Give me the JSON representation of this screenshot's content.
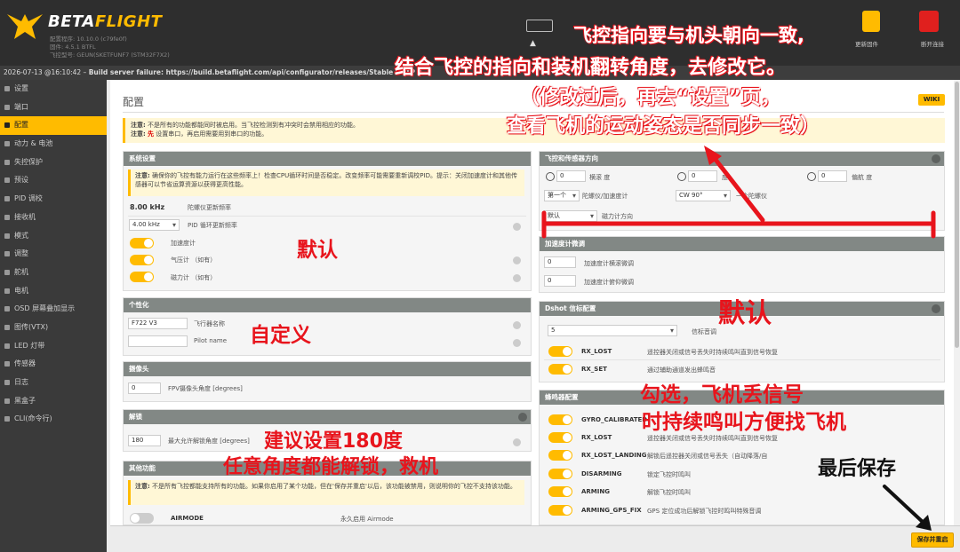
{
  "header": {
    "logo_part1": "BETA",
    "logo_part2": "FLIGHT",
    "fw_line1": "配置程序: 10.10.0 (c79fe0f)",
    "fw_line2": "固件: 4.5.1 BTFL",
    "fw_line3": "飞控型号: GEUN(SKETFUNF7 (STM32F7X2)",
    "right_label1": "更新固件",
    "right_label2": "断开连接",
    "accent_color": "#ffbb00",
    "icons": [
      "betaflight-logo",
      "usb-icon",
      "warning-icon",
      "chip-icon",
      "disconnect-icon"
    ]
  },
  "logbar": {
    "timestamp": "2026-07-13 @16:10:42 –",
    "message": "Build server failure: https://build.betaflight.com/api/configurator/releases/Stable HTTP",
    "code": "0"
  },
  "sidebar": {
    "items": [
      {
        "label": "设置"
      },
      {
        "label": "端口"
      },
      {
        "label": "配置",
        "active": true
      },
      {
        "label": "动力 & 电池"
      },
      {
        "label": "失控保护"
      },
      {
        "label": "预设"
      },
      {
        "label": "PID 调校"
      },
      {
        "label": "接收机"
      },
      {
        "label": "模式"
      },
      {
        "label": "调整"
      },
      {
        "label": "舵机"
      },
      {
        "label": "电机"
      },
      {
        "label": "OSD 屏幕叠加显示"
      },
      {
        "label": "图传(VTX)"
      },
      {
        "label": "LED 灯带"
      },
      {
        "label": "传感器"
      },
      {
        "label": "日志"
      },
      {
        "label": "黑盒子"
      },
      {
        "label": "CLI(命令行)"
      }
    ]
  },
  "page": {
    "title": "配置",
    "wiki": "WIKI",
    "notice_b1": "注意:",
    "notice_t1": "不是所有的功能都能同时被启用。当飞控检测到有冲突时会禁用相应的功能。",
    "notice_b2": "注意:",
    "notice_b3": "先",
    "notice_t2": "设置串口，再启用需要用到串口的功能。"
  },
  "system": {
    "title": "系统设置",
    "note_b": "注意:",
    "note_t": "确保你的飞控有能力运行在这些频率上！检查CPU循环时间是否稳定。改变频率可能需要重新调校PID。提示：关闭加速度计和其他传感器可以节省运算资源以获得更高性能。",
    "gyro_freq": "8.00 kHz",
    "gyro_freq_label": "陀螺仪更新频率",
    "pid_freq": "4.00 kHz",
    "pid_freq_label": "PID 循环更新频率",
    "accel": "加速度计",
    "baro": "气压计 （如有）",
    "mag": "磁力计 （如有）"
  },
  "personal": {
    "title": "个性化",
    "craft_name": "F722 V3",
    "craft_name_label": "飞行器名称",
    "pilot_name": "",
    "pilot_name_label": "Pilot name"
  },
  "camera": {
    "title": "摄像头",
    "angle": "0",
    "angle_label": "FPV摄像头角度 [degrees]"
  },
  "arming": {
    "title": "解锁",
    "angle": "180",
    "angle_label": "最大允许解锁角度 [degrees]"
  },
  "other": {
    "title": "其他功能",
    "note_b": "注意:",
    "note_t": "不是所有飞控都能支持所有的功能。如果你启用了某个功能，但在'保存并重启'以后，该功能被禁用，则说明你的飞控不支持该功能。",
    "airmode": "AIRMODE",
    "airmode_desc": "永久启用 Airmode"
  },
  "board": {
    "title": "飞控和传感器方向",
    "roll": "0",
    "roll_label": "横滚 度",
    "pitch": "0",
    "pitch_label": "度",
    "yaw": "0",
    "yaw_label": "偏航 度",
    "gyro_select": "第一个",
    "gyro_select_label": "陀螺仪/加速度计",
    "gyro_align": "CW 90°",
    "gyro_align_label": "一个陀螺仪",
    "mag_align": "默认",
    "mag_align_label": "磁力计方向"
  },
  "accel_trim": {
    "title": "加速度计微调",
    "roll": "0",
    "roll_label": "加速度计横滚微调",
    "pitch": "0",
    "pitch_label": "加速度计俯仰微调"
  },
  "dshot": {
    "title": "Dshot 信标配置",
    "tone": "5",
    "tone_label": "信标音调",
    "rows": [
      {
        "name": "RX_LOST",
        "desc": "遥控器关闭或信号丢失时持续鸣叫直到信号恢复"
      },
      {
        "name": "RX_SET",
        "desc": "通过辅助通道发出蜂鸣音"
      }
    ]
  },
  "buzzer": {
    "title": "蜂鸣器配置",
    "rows": [
      {
        "name": "GYRO_CALIBRATED",
        "desc": ""
      },
      {
        "name": "RX_LOST",
        "desc": "遥控器关闭或信号丢失时持续鸣叫直到信号恢复"
      },
      {
        "name": "RX_LOST_LANDING",
        "desc": "解锁后遥控器关闭或信号丢失（自动降落/自"
      },
      {
        "name": "DISARMING",
        "desc": "锁定飞控时鸣叫"
      },
      {
        "name": "ARMING",
        "desc": "解锁飞控时鸣叫"
      },
      {
        "name": "ARMING_GPS_FIX",
        "desc": "GPS 定位成功后解锁飞控时鸣叫特殊音调"
      }
    ]
  },
  "footer": {
    "save": "保存并重启"
  },
  "annotations": {
    "top1": "飞控指向要与机头朝向一致,",
    "top2": "结合飞控的指向和装机翻转角度，去修改它。",
    "top3": "（修改过后，再去“设置”页，",
    "top4": "查看飞机的运动姿态是否同步一致）",
    "default1": "默认",
    "custom": "自定义",
    "default2": "默认",
    "buzzer1": "勾选，飞机丢信号",
    "buzzer2": "时持续鸣叫方便找飞机",
    "arm1": "建议设置180度",
    "arm2": "任意角度都能解锁，救机",
    "save": "最后保存",
    "red_color": "#e8141c"
  }
}
